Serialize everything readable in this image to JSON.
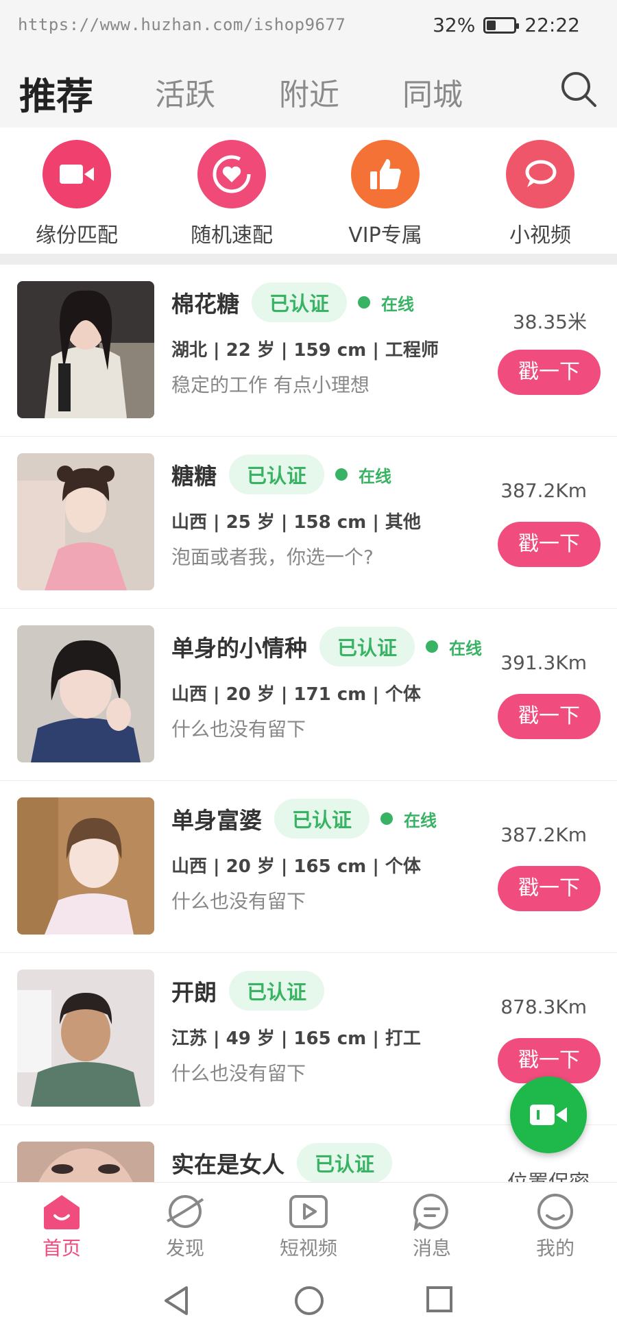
{
  "status_bar": {
    "watermark": "https://www.huzhan.com/ishop9677",
    "battery_text": "32%",
    "battery_level": 0.32,
    "time": "22:22"
  },
  "top_tabs": [
    "推荐",
    "活跃",
    "附近",
    "同城"
  ],
  "active_tab": "推荐",
  "quick_actions": [
    {
      "label": "缘份匹配",
      "icon": "video-camera-icon",
      "color": "#f0406e"
    },
    {
      "label": "随机速配",
      "icon": "heart-ring-icon",
      "color": "#ef4a78"
    },
    {
      "label": "VIP专属",
      "icon": "thumbs-up-icon",
      "color": "#f47236"
    },
    {
      "label": "小视频",
      "icon": "chat-bubble-icon",
      "color": "#f0566a"
    }
  ],
  "users": [
    {
      "name": "棉花糖",
      "verified": "已认证",
      "online": "在线",
      "info": "湖北 | 22 岁 | 159 cm | 工程师",
      "bio": "稳定的工作 有点小理想",
      "distance": "38.35米",
      "action": "戳一下"
    },
    {
      "name": "糖糖",
      "verified": "已认证",
      "online": "在线",
      "info": "山西 | 25 岁 | 158 cm | 其他",
      "bio": "泡面或者我，你选一个?",
      "distance": "387.2Km",
      "action": "戳一下"
    },
    {
      "name": "单身的小情种",
      "verified": "已认证",
      "online": "在线",
      "info": "山西 | 20 岁 | 171 cm | 个体",
      "bio": "什么也没有留下",
      "distance": "391.3Km",
      "action": "戳一下"
    },
    {
      "name": "单身富婆",
      "verified": "已认证",
      "online": "在线",
      "info": "山西 | 20 岁 | 165 cm | 个体",
      "bio": "什么也没有留下",
      "distance": "387.2Km",
      "action": "戳一下"
    },
    {
      "name": "开朗",
      "verified": "已认证",
      "online": "",
      "info": "江苏 | 49 岁 | 165 cm | 打工",
      "bio": "什么也没有留下",
      "distance": "878.3Km",
      "action": "戳一下"
    },
    {
      "name": "实在是女人",
      "verified": "已认证",
      "online": "",
      "info": "",
      "bio": "",
      "distance": "位置保密",
      "action": ""
    }
  ],
  "fab": {
    "icon": "video-camera-icon",
    "color": "#1fb84a"
  },
  "bottom_nav": [
    {
      "label": "首页",
      "icon": "home-icon"
    },
    {
      "label": "发现",
      "icon": "planet-icon"
    },
    {
      "label": "短视频",
      "icon": "play-icon"
    },
    {
      "label": "消息",
      "icon": "message-icon"
    },
    {
      "label": "我的",
      "icon": "smile-icon"
    }
  ],
  "accent_color": "#f04d7e",
  "verified_color": "#38b364"
}
